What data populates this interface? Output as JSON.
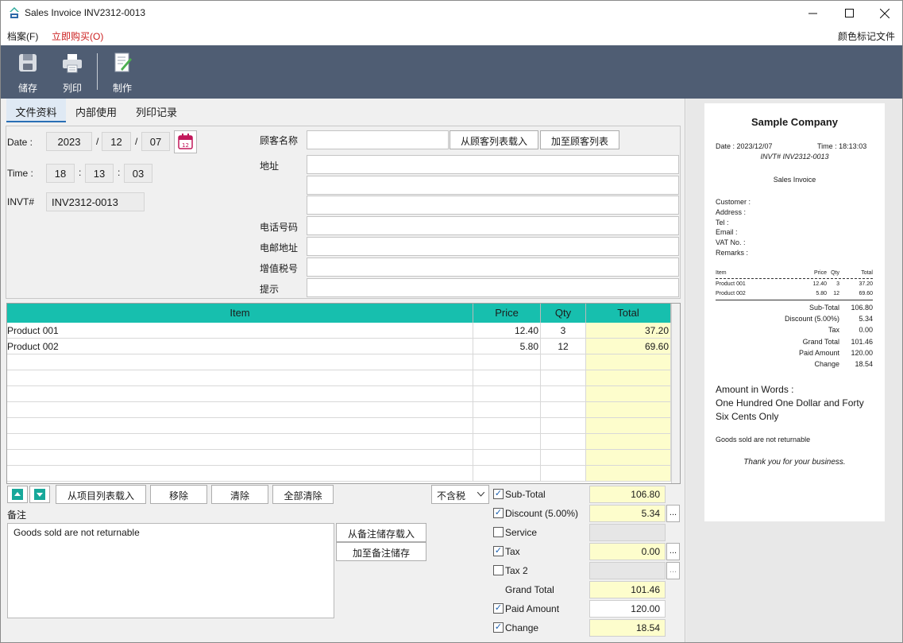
{
  "window": {
    "title": "Sales Invoice INV2312-0013",
    "minimize": "—",
    "maximize": "☐",
    "close": "✕"
  },
  "menu": {
    "file": "档案(F)",
    "buy": "立即购买(O)",
    "color_mark": "颜色标记文件"
  },
  "toolbar": {
    "save": "储存",
    "print": "列印",
    "make": "制作"
  },
  "tabs": [
    "文件资料",
    "内部使用",
    "列印记录"
  ],
  "doc": {
    "date_label": "Date :",
    "year": "2023",
    "month": "12",
    "day": "07",
    "sep_date": "/",
    "time_label": "Time :",
    "hour": "18",
    "minute": "13",
    "second": "03",
    "sep_time": ":",
    "invt_label": "INVT#",
    "invt": "INV2312-0013"
  },
  "customer": {
    "name_label": "顾客名称",
    "name": "",
    "load_btn": "从顾客列表载入",
    "add_btn": "加至顾客列表",
    "address_label": "地址",
    "address1": "",
    "address2": "",
    "address3": "",
    "tel_label": "电话号码",
    "tel": "",
    "email_label": "电邮地址",
    "email": "",
    "vat_label": "增值税号",
    "vat": "",
    "remark_label": "提示",
    "remark": ""
  },
  "grid": {
    "headers": {
      "item": "Item",
      "price": "Price",
      "qty": "Qty",
      "total": "Total"
    },
    "rows": [
      {
        "item": "Product 001",
        "price": "12.40",
        "qty": "3",
        "total": "37.20"
      },
      {
        "item": "Product 002",
        "price": "5.80",
        "qty": "12",
        "total": "69.60"
      }
    ],
    "empty_rows": 8
  },
  "actions": {
    "load_items": "从项目列表载入",
    "remove": "移除",
    "clear": "清除",
    "clear_all": "全部清除",
    "tax_mode": "不含税"
  },
  "notes": {
    "label": "备注",
    "text": "Goods sold are not returnable",
    "load_btn": "从备注储存载入",
    "save_btn": "加至备注储存"
  },
  "summary": {
    "subtotal_label": "Sub-Total",
    "subtotal": "106.80",
    "subtotal_checked": true,
    "discount_label": "Discount (5.00%)",
    "discount": "5.34",
    "discount_checked": true,
    "service_label": "Service",
    "service": "",
    "service_checked": false,
    "tax_label": "Tax",
    "tax": "0.00",
    "tax_checked": true,
    "tax2_label": "Tax 2",
    "tax2": "",
    "tax2_checked": false,
    "grand_label": "Grand Total",
    "grand": "101.46",
    "paid_label": "Paid Amount",
    "paid": "120.00",
    "paid_checked": true,
    "change_label": "Change",
    "change": "18.54",
    "change_checked": true,
    "dots": "..."
  },
  "receipt": {
    "company": "Sample Company",
    "date": "Date : 2023/12/07",
    "time": "Time : 18:13:03",
    "invt": "INVT# INV2312-0013",
    "doc_type": "Sales Invoice",
    "customer": "Customer :",
    "address": "Address :",
    "tel": "Tel :",
    "email": "Email :",
    "vat": "VAT No. :",
    "remarks": "Remarks :",
    "col_item": "Item",
    "col_price": "Price",
    "col_qty": "Qty",
    "col_total": "Total",
    "lines": [
      {
        "item": "Product 001",
        "price": "12.40",
        "qty": "3",
        "total": "37.20"
      },
      {
        "item": "Product 002",
        "price": "5.80",
        "qty": "12",
        "total": "69.60"
      }
    ],
    "sub_total_label": "Sub-Total",
    "sub_total": "106.80",
    "discount_label": "Discount (5.00%)",
    "discount": "5.34",
    "tax_label": "Tax",
    "tax": "0.00",
    "grand_label": "Grand Total",
    "grand": "101.46",
    "paid_label": "Paid Amount",
    "paid": "120.00",
    "change_label": "Change",
    "change": "18.54",
    "words_label": "Amount in Words :",
    "words_line1": "One Hundred One Dollar and Forty",
    "words_line2": "Six Cents Only",
    "note": "Goods sold are not returnable",
    "thanks": "Thank you for your business."
  },
  "colors": {
    "toolbar": "#4f5d73",
    "grid_header": "#17bfae",
    "total_col": "#fdfdcc",
    "buy_menu": "#cc1f1f"
  }
}
